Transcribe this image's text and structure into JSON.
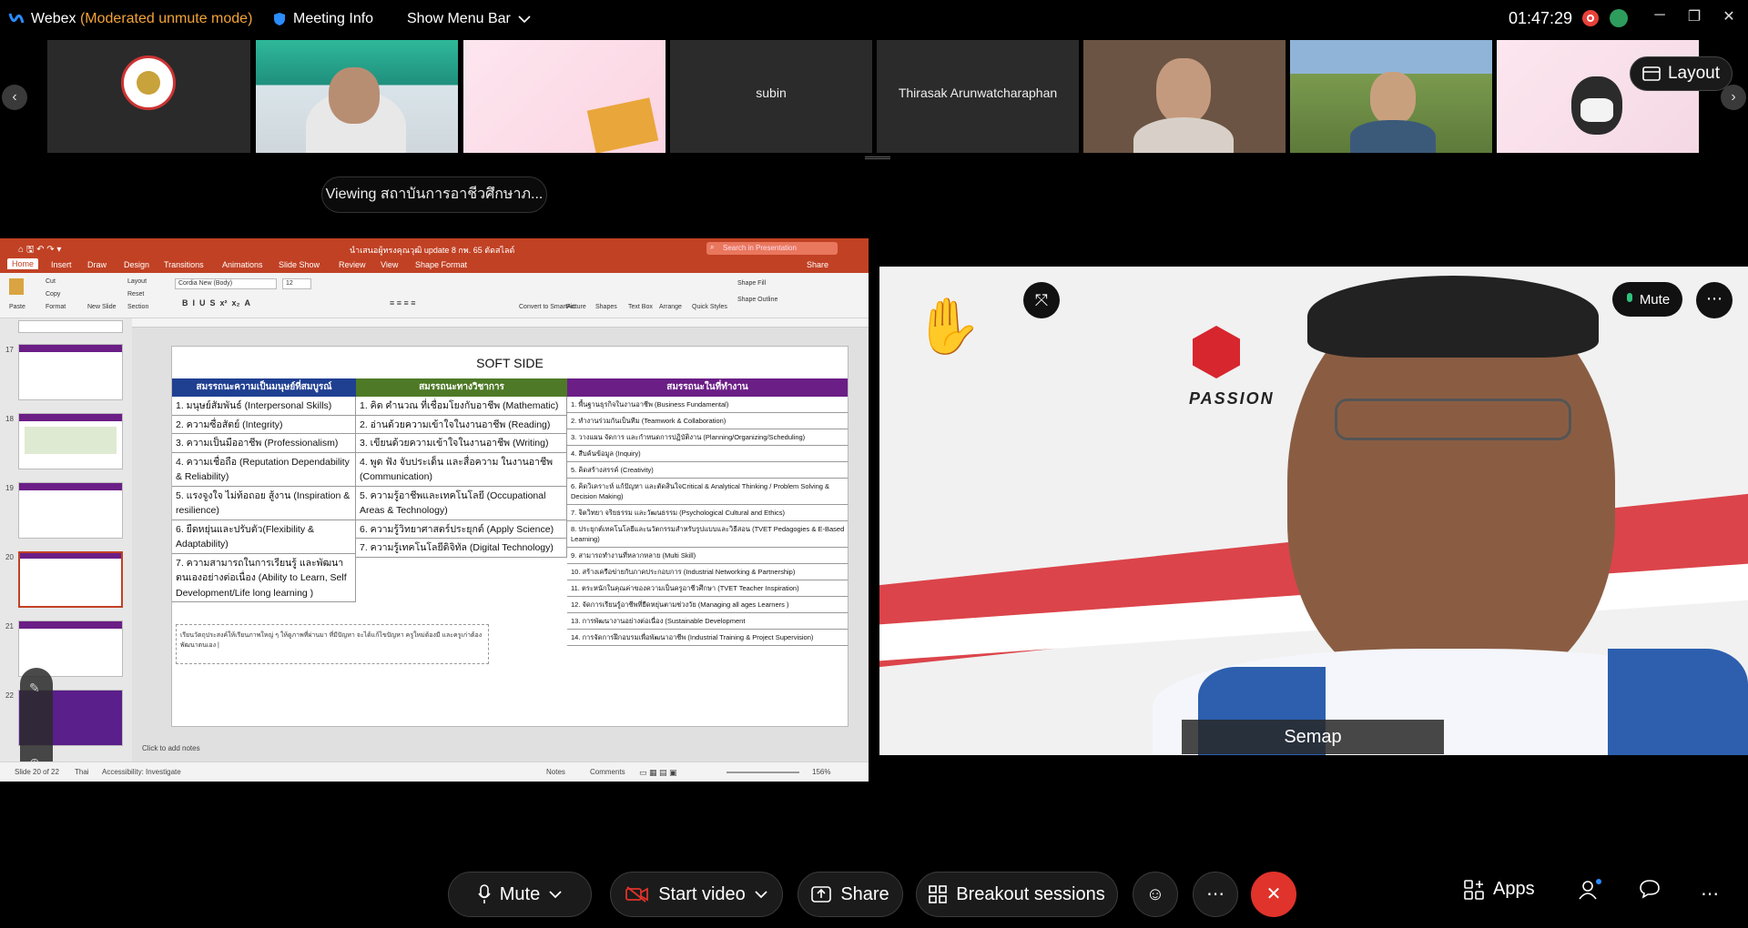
{
  "titlebar": {
    "app_name": "Webex",
    "mode": "(Moderated unmute mode)",
    "meeting_info": "Meeting Info",
    "menu_bar": "Show Menu Bar",
    "time": "01:47:29"
  },
  "filmstrip": {
    "tiles": [
      {
        "name": ""
      },
      {
        "name": ""
      },
      {
        "name": ""
      },
      {
        "name": "subin"
      },
      {
        "name": "Thirasak Arunwatcharaphan"
      },
      {
        "name": ""
      },
      {
        "name": ""
      },
      {
        "name": ""
      }
    ],
    "layout_label": "Layout"
  },
  "viewing_label": "Viewing สถาบันการอาชีวศึกษาภ...",
  "ppt": {
    "doc_title": "นำเสนอผู้ทรงคุณวุฒิ update 8 กพ. 65 ตัดสไลด์",
    "search_placeholder": "Search in Presentation",
    "tabs": [
      "Home",
      "Insert",
      "Draw",
      "Design",
      "Transitions",
      "Animations",
      "Slide Show",
      "Review",
      "View",
      "Shape Format"
    ],
    "share_label": "Share",
    "ribbon": {
      "paste": "Paste",
      "cut": "Cut",
      "copy": "Copy",
      "format": "Format",
      "new_slide": "New Slide",
      "layout": "Layout",
      "reset": "Reset",
      "section": "Section",
      "font": "Cordia New (Body)",
      "font_size": "12",
      "convert": "Convert to SmartArt",
      "picture": "Picture",
      "shapes": "Shapes",
      "textbox": "Text Box",
      "arrange": "Arrange",
      "quick_styles": "Quick Styles",
      "shape_fill": "Shape Fill",
      "shape_outline": "Shape Outline"
    },
    "thumb_numbers": [
      "17",
      "18",
      "19",
      "20",
      "21",
      "22"
    ],
    "slide": {
      "title": "SOFT SIDE",
      "col1_head": "สมรรถนะความเป็นมนุษย์ที่สมบูรณ์",
      "col2_head": "สมรรถนะทางวิชาการ",
      "col3_head": "สมรรถนะในที่ทำงาน",
      "col1": [
        "1. มนุษย์สัมพันธ์ (Interpersonal Skills)",
        "2. ความซื่อสัตย์ (Integrity)",
        "3. ความเป็นมืออาชีพ (Professionalism)",
        "4. ความเชื่อถือ (Reputation Dependability & Reliability)",
        "5. แรงจูงใจ ไม่ท้อถอย สู้งาน (Inspiration & resilience)",
        "6. ยืดหยุ่นและปรับตัว(Flexibility & Adaptability)",
        "7. ความสามารถในการเรียนรู้ และพัฒนาตนเองอย่างต่อเนื่อง (Ability to Learn, Self Development/Life long learning )"
      ],
      "col2": [
        "1. คิด คำนวณ ที่เชื่อมโยงกับอาชีพ (Mathematic)",
        "2. อ่านด้วยความเข้าใจในงานอาชีพ (Reading)",
        "3. เขียนด้วยความเข้าใจในงานอาชีพ (Writing)",
        "4. พูด ฟัง จับประเด็น และสื่อความ ในงานอาชีพ (Communication)",
        "5. ความรู้อาชีพและเทคโนโลยี (Occupational Areas & Technology)",
        "6. ความรู้วิทยาศาสตร์ประยุกต์ (Apply Science)",
        "7. ความรู้เทคโนโลยีดิจิทัล (Digital Technology)"
      ],
      "col3": [
        "1. พื้นฐานธุรกิจในงานอาชีพ (Business Fundamental)",
        "2. ทำงานร่วมกันเป็นทีม (Teamwork & Collaboration)",
        "3. วางแผน จัดการ และกำหนดการปฏิบัติงาน (Planning/Organizing/Scheduling)",
        "4. สืบค้นข้อมูล (Inquiry)",
        "5. คิดสร้างสรรค์ (Creativity)",
        "6. คิดวิเคราะห์ แก้ปัญหา และตัดสินใจCritical & Analytical Thinking / Problem Solving & Decision Making)",
        "7. จิตวิทยา จริยธรรม และวัฒนธรรม (Psychological Cultural and Ethics)",
        "8. ประยุกต์เทคโนโลยีและนวัตกรรมสำหรับรูปแบบและวิธีสอน (TVET Pedagogies & E-Based Learning)",
        "9. สามารถทำงานที่หลากหลาย (Multi Skill)",
        "10. สร้างเครือข่ายกับภาคประกอบการ (Industrial Networking & Partnership)",
        "11. ตระหนักในคุณค่าของความเป็นครูอาชีวศึกษา (TVET Teacher Inspiration)",
        "12. จัดการเรียนรู้อาชีพที่ยืดหยุ่นตามช่วงวัย (Managing all ages Learners )",
        "13. การพัฒนางานอย่างต่อเนื่อง (Sustainable Development",
        "14. การจัดการฝึกอบรมเพื่อพัฒนาอาชีพ (Industrial Training & Project Supervision)"
      ],
      "note": "เรียนวัตถุประสงค์ให้เรียนภาพใหญ่ ๆ ให้ดูภาพที่ผ่านมา ที่มีปัญหา จะได้แก้ไขปัญหา ครูใหม่ต้องมี และครูเก่าต้องพัฒนาตนเอง |"
    },
    "add_notes": "Click to add notes",
    "status": {
      "slide_count": "Slide 20 of 22",
      "language": "Thai",
      "accessibility": "Accessibility: Investigate",
      "notes": "Notes",
      "comments": "Comments",
      "zoom": "156%"
    }
  },
  "video": {
    "speaker_name": "Semap",
    "mute_label": "Mute",
    "brand_text": "PASSION"
  },
  "controls": {
    "mute": "Mute",
    "start_video": "Start video",
    "share": "Share",
    "breakout": "Breakout sessions",
    "apps": "Apps"
  },
  "colors": {
    "mode_orange": "#f2a33a",
    "ppt_red": "#c14124",
    "leave_red": "#e0332b",
    "col1_blue": "#1f3f91",
    "col2_green": "#4e7a27",
    "col3_purple": "#6b1e86"
  }
}
